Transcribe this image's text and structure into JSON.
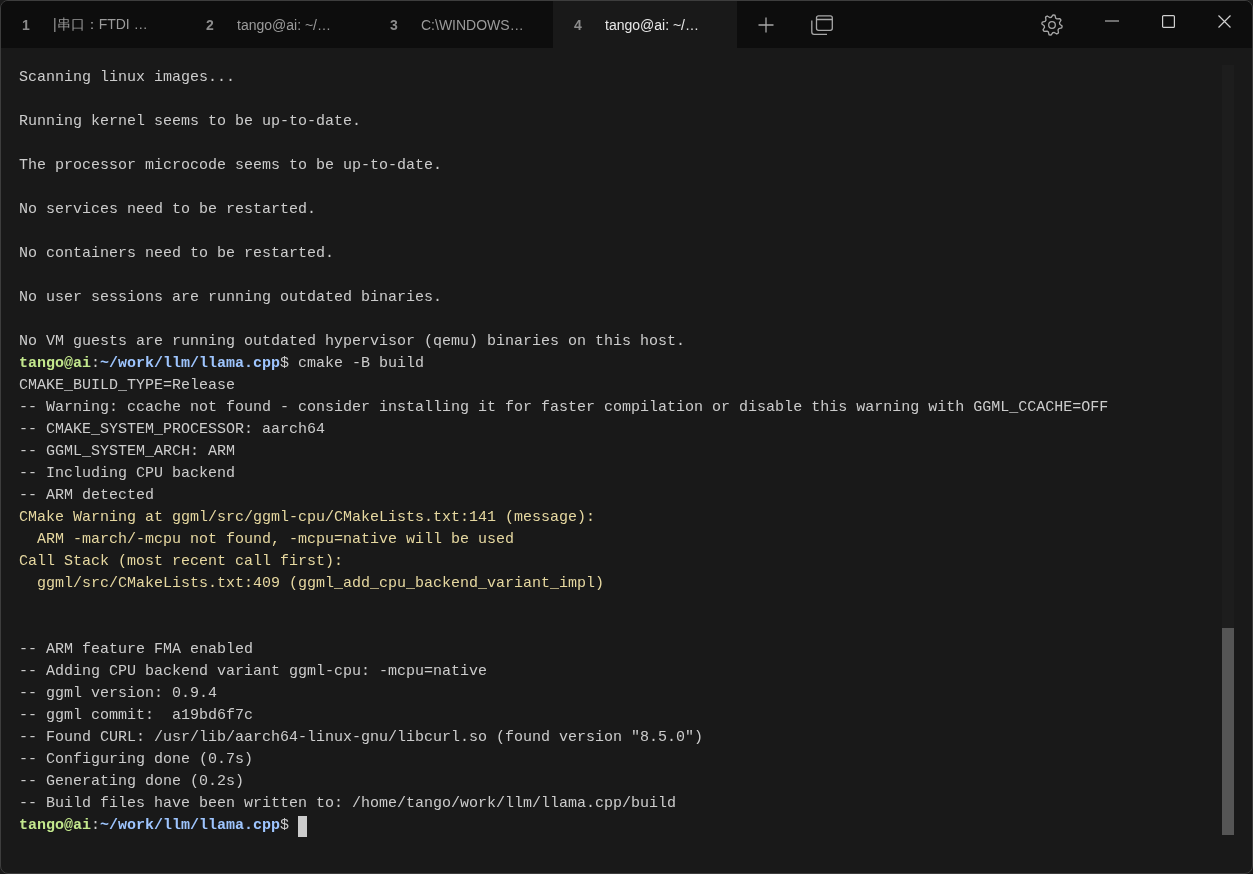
{
  "tabs": [
    {
      "number": "1",
      "title": "|串口：FTDI …",
      "selected": false
    },
    {
      "number": "2",
      "title": "tango@ai: ~/…",
      "selected": false
    },
    {
      "number": "3",
      "title": "C:\\WINDOWS…",
      "selected": false
    },
    {
      "number": "4",
      "title": "tango@ai: ~/…",
      "selected": true
    }
  ],
  "terminal": {
    "lines": [
      {
        "kind": "text",
        "text": "Scanning linux images..."
      },
      {
        "kind": "blank"
      },
      {
        "kind": "text",
        "text": "Running kernel seems to be up-to-date."
      },
      {
        "kind": "blank"
      },
      {
        "kind": "text",
        "text": "The processor microcode seems to be up-to-date."
      },
      {
        "kind": "blank"
      },
      {
        "kind": "text",
        "text": "No services need to be restarted."
      },
      {
        "kind": "blank"
      },
      {
        "kind": "text",
        "text": "No containers need to be restarted."
      },
      {
        "kind": "blank"
      },
      {
        "kind": "text",
        "text": "No user sessions are running outdated binaries."
      },
      {
        "kind": "blank"
      },
      {
        "kind": "text",
        "text": "No VM guests are running outdated hypervisor (qemu) binaries on this host."
      },
      {
        "kind": "prompt",
        "user_host": "tango@ai",
        "separator": ":",
        "path": "~/work/llm/llama.cpp",
        "symbol": "$",
        "command": "cmake -B build"
      },
      {
        "kind": "text",
        "text": "CMAKE_BUILD_TYPE=Release"
      },
      {
        "kind": "text",
        "text": "-- Warning: ccache not found - consider installing it for faster compilation or disable this warning with GGML_CCACHE=OFF"
      },
      {
        "kind": "text",
        "text": "-- CMAKE_SYSTEM_PROCESSOR: aarch64"
      },
      {
        "kind": "text",
        "text": "-- GGML_SYSTEM_ARCH: ARM"
      },
      {
        "kind": "text",
        "text": "-- Including CPU backend"
      },
      {
        "kind": "text",
        "text": "-- ARM detected"
      },
      {
        "kind": "warning",
        "text": "CMake Warning at ggml/src/ggml-cpu/CMakeLists.txt:141 (message):"
      },
      {
        "kind": "warning",
        "text": "  ARM -march/-mcpu not found, -mcpu=native will be used"
      },
      {
        "kind": "warning",
        "text": "Call Stack (most recent call first):"
      },
      {
        "kind": "warning",
        "text": "  ggml/src/CMakeLists.txt:409 (ggml_add_cpu_backend_variant_impl)"
      },
      {
        "kind": "blank"
      },
      {
        "kind": "blank"
      },
      {
        "kind": "text",
        "text": "-- ARM feature FMA enabled"
      },
      {
        "kind": "text",
        "text": "-- Adding CPU backend variant ggml-cpu: -mcpu=native"
      },
      {
        "kind": "text",
        "text": "-- ggml version: 0.9.4"
      },
      {
        "kind": "text",
        "text": "-- ggml commit:  a19bd6f7c"
      },
      {
        "kind": "text",
        "text": "-- Found CURL: /usr/lib/aarch64-linux-gnu/libcurl.so (found version \"8.5.0\")"
      },
      {
        "kind": "text",
        "text": "-- Configuring done (0.7s)"
      },
      {
        "kind": "text",
        "text": "-- Generating done (0.2s)"
      },
      {
        "kind": "text",
        "text": "-- Build files have been written to: /home/tango/work/llm/llama.cpp/build"
      },
      {
        "kind": "prompt",
        "user_host": "tango@ai",
        "separator": ":",
        "path": "~/work/llm/llama.cpp",
        "symbol": "$",
        "cursor": true
      }
    ]
  }
}
